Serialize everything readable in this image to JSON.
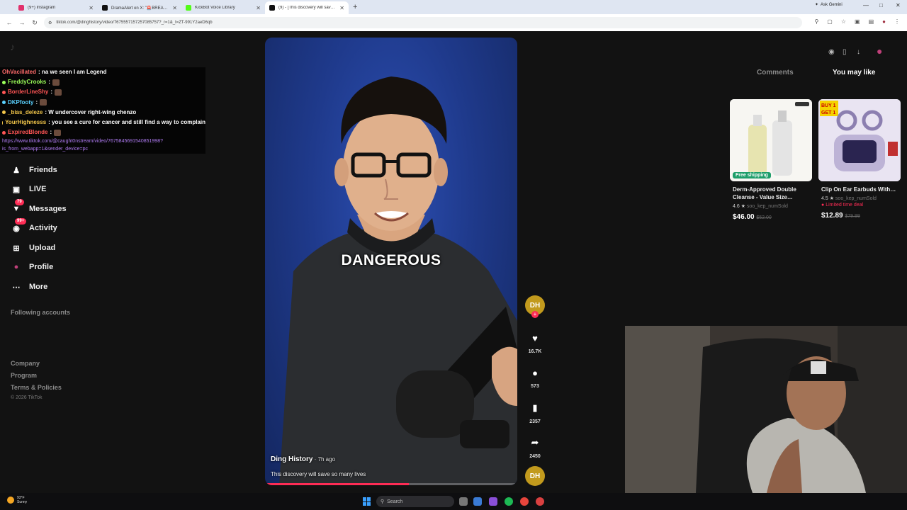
{
  "browser": {
    "tabs": [
      {
        "label": "(9+) Instagram",
        "color": "#e1306c",
        "active": false
      },
      {
        "label": "DramaAlert on X: \"🚨BREAKI…",
        "color": "#111111",
        "active": false
      },
      {
        "label": "KickBot Voice Library",
        "color": "#53fc18",
        "active": false
      },
      {
        "label": "(9) - [This discovery will save so…",
        "color": "#111111",
        "active": true
      }
    ],
    "new_tab": "+",
    "ask_gemini": "Ask Gemini",
    "url": "tiktok.com/@dinghistory/video/7675557157257085757?_r=1&_t=ZT-991Y2aeD6qb"
  },
  "sidebar": {
    "items": [
      {
        "label": "Friends",
        "icon": "friends-icon",
        "badge": ""
      },
      {
        "label": "LIVE",
        "icon": "live-icon",
        "badge": ""
      },
      {
        "label": "Messages",
        "icon": "messages-icon",
        "badge": "79"
      },
      {
        "label": "Activity",
        "icon": "activity-icon",
        "badge": "99+"
      },
      {
        "label": "Upload",
        "icon": "upload-icon",
        "badge": ""
      },
      {
        "label": "Profile",
        "icon": "profile-icon",
        "badge": ""
      },
      {
        "label": "More",
        "icon": "more-icon",
        "badge": ""
      }
    ],
    "following_accounts": "Following accounts",
    "footer": [
      "Company",
      "Program",
      "Terms & Policies"
    ],
    "copyright": "© 2026 TikTok"
  },
  "chat": {
    "messages": [
      {
        "user": "OhVacillated",
        "color": "#ff6b6b",
        "text": ": na we seen I am Legend"
      },
      {
        "user": "FreddyCrooks",
        "color": "#9cff5a",
        "text": " :"
      },
      {
        "user": "BorderLineShy",
        "color": "#ff5555",
        "text": " :"
      },
      {
        "user": "DKPfooty",
        "color": "#5ad1ff",
        "text": " :"
      },
      {
        "user": "_bias_deleze",
        "color": "#f3c64a",
        "text": " : W  undercover right-wing chenzo"
      },
      {
        "user": "YourHighnesss",
        "color": "#f3c64a",
        "text": " : you see a cure for cancer and still find a way to complain"
      },
      {
        "user": "ExpiredBlonde",
        "color": "#ff5555",
        "text": " :"
      }
    ],
    "link": "https://www.tiktok.com/@caught0nstream/video/7675845691540851998?is_from_webapp=1&sender_device=pc"
  },
  "video": {
    "caption": "DANGEROUS",
    "author": "Ding History",
    "ago": " · 7h ago",
    "description": "This discovery will save so many lives",
    "progress": 0.57,
    "avatar_initials": "DH",
    "likes": "16.7K",
    "comments": "573",
    "saves": "2357",
    "shares": "2450"
  },
  "right_panel": {
    "tabs": [
      "Comments",
      "You may like"
    ],
    "products": [
      {
        "title": "Derm-Approved Double Cleanse - Value Size…",
        "rating": "4.6",
        "sold": "soo_kep_numSold",
        "limited": "",
        "price": "$46.00",
        "old_price": "$52.00",
        "badge": "Free shipping"
      },
      {
        "title": "Clip On Ear Earbuds With…",
        "rating": "4.5",
        "sold": "soo_kep_numSold",
        "limited": "Limited time deal",
        "price": "$12.89",
        "old_price": "$79.99",
        "badge": ""
      }
    ]
  },
  "taskbar": {
    "temp": "93°F",
    "weather": "Sunny",
    "search": "Search"
  },
  "colors": {
    "accent": "#fe2c55",
    "page_bg": "#121212",
    "avatar_gold": "#c29a1d"
  }
}
